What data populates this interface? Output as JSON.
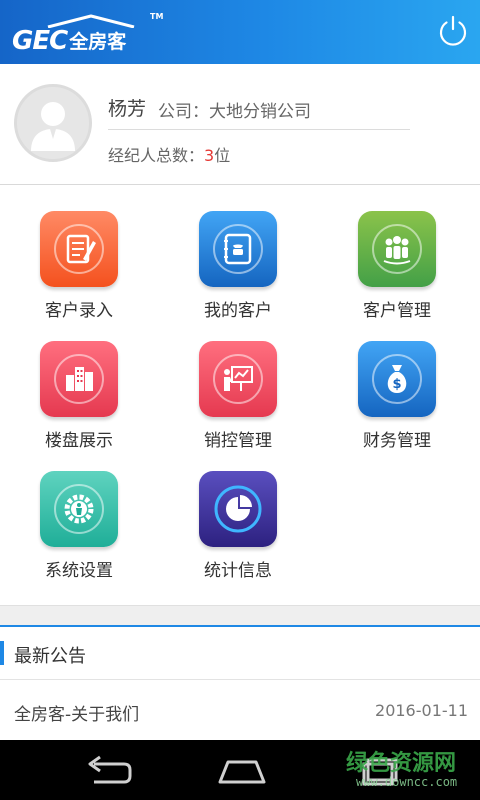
{
  "header": {
    "logo_gec": "GEC",
    "logo_cn": "全房客",
    "logo_tm": "TM"
  },
  "profile": {
    "name": "杨芳",
    "company": "公司：大地分销公司",
    "agents_label": "经纪人总数：",
    "agents_count": "3",
    "agents_unit": "位"
  },
  "menu": [
    {
      "label": "客户录入",
      "icon": "customer-entry-icon",
      "color1": "#ff8a65",
      "color2": "#f4511e"
    },
    {
      "label": "我的客户",
      "icon": "address-book-icon",
      "color1": "#42a5f5",
      "color2": "#1565c0"
    },
    {
      "label": "客户管理",
      "icon": "people-group-icon",
      "color1": "#8bc34a",
      "color2": "#43a047"
    },
    {
      "label": "楼盘展示",
      "icon": "buildings-icon",
      "color1": "#ff6f7f",
      "color2": "#e53950"
    },
    {
      "label": "销控管理",
      "icon": "presentation-board-icon",
      "color1": "#ff6f7f",
      "color2": "#e53950"
    },
    {
      "label": "财务管理",
      "icon": "money-bag-icon",
      "color1": "#42a5f5",
      "color2": "#1565c0"
    },
    {
      "label": "系统设置",
      "icon": "settings-gear-icon",
      "color1": "#5fd3bf",
      "color2": "#1fae98"
    },
    {
      "label": "统计信息",
      "icon": "pie-chart-icon",
      "color1": "#7b6fd6",
      "color2": "#3e2f9c"
    }
  ],
  "notice": {
    "title": "最新公告",
    "items": [
      {
        "text": "全房客-关于我们",
        "date": "2016-01-11"
      }
    ]
  },
  "watermark": {
    "cn": "绿色资源网",
    "en": "www.downcc.com"
  },
  "colors": {
    "header_start": "#1565c8",
    "header_end": "#2aa6f0",
    "accent": "#1e88e5",
    "highlight_red": "#e53935"
  }
}
